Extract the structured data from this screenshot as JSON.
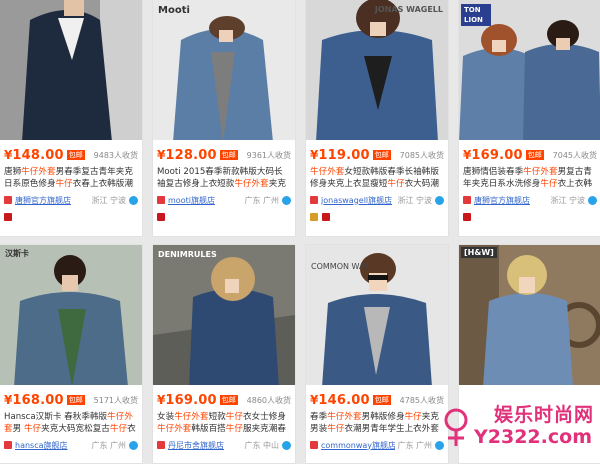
{
  "products": [
    {
      "price": "148.00",
      "badge": "包邮",
      "sales": "9483人收货",
      "title_parts": [
        "唐狮",
        "牛仔外套",
        "男春季复古青年夹克日系原色修身",
        "牛仔",
        "衣春上衣韩版潮"
      ],
      "shop": "唐狮官方旗舰店",
      "location": "浙江 宁波",
      "brand_logo": ""
    },
    {
      "price": "128.00",
      "badge": "包邮",
      "sales": "9361人收货",
      "title_parts": [
        "",
        "",
        "Mooti 2015春季新款韩版大码长袖复古修身上衣短款",
        "牛仔外套",
        "夹克女"
      ],
      "shop": "mooti旗舰店",
      "location": "广东 广州",
      "brand_logo": "Mooti"
    },
    {
      "price": "119.00",
      "badge": "包邮",
      "sales": "7085人收货",
      "title_parts": [
        "",
        "牛仔外套",
        "女短款韩版春季长袖韩版修身夹克上衣显瘦短",
        "牛仔",
        "衣大码潮"
      ],
      "shop": "jonaswagell旗舰店",
      "location": "浙江 宁波",
      "brand_logo": "JONAS WAGELL"
    },
    {
      "price": "169.00",
      "badge": "包邮",
      "sales": "7045人收货",
      "title_parts": [
        "唐狮情侣装春季",
        "牛仔外套",
        "男复古青年夹克日系水洗修身",
        "牛仔",
        "衣上衣韩版潮"
      ],
      "shop": "唐狮官方旗舰店",
      "location": "浙江 宁波",
      "brand_logo": "TON LION"
    },
    {
      "price": "168.00",
      "badge": "包邮",
      "sales": "5171人收货",
      "title_parts": [
        "Hansca汉斯卡 春秋季韩版",
        "牛仔外套",
        "男 ",
        "牛仔",
        "夹克大码宽松复古",
        "牛仔",
        "衣"
      ],
      "shop": "hansca旗舰店",
      "location": "广东 广州",
      "brand_logo": "汉斯卡"
    },
    {
      "price": "169.00",
      "badge": "包邮",
      "sales": "4860人收货",
      "title_parts": [
        "女装",
        "牛仔外套",
        "短款",
        "牛仔",
        "衣女士修身",
        "牛仔外套",
        "韩版百搭",
        "牛仔",
        "服夹克潮春秋"
      ],
      "shop": "丹尼市舍旗舰店",
      "location": "广东 中山",
      "brand_logo": "DENIMRULES"
    },
    {
      "price": "146.00",
      "badge": "包邮",
      "sales": "4785人收货",
      "title_parts": [
        "春季",
        "牛仔外套",
        "男韩版修身",
        "牛仔",
        "夹克男装",
        "牛仔",
        "衣潮男青年学生上衣外套男"
      ],
      "shop": "commonway旗舰店",
      "location": "广东 广州",
      "brand_logo": "COMMON WAY"
    },
    {
      "price": "",
      "badge": "",
      "sales": "",
      "title_parts": [
        "",
        "",
        "",
        "",
        ""
      ],
      "shop": "",
      "location": "",
      "brand_logo": "[H&W]"
    }
  ],
  "watermark": {
    "line1": "娱乐时尚网",
    "line2": "Y2322.com"
  },
  "colors": {
    "price": "#ff4400",
    "badge_bg": "#ff4400",
    "shop_link": "#3366cc",
    "watermark": "#e0317a"
  }
}
